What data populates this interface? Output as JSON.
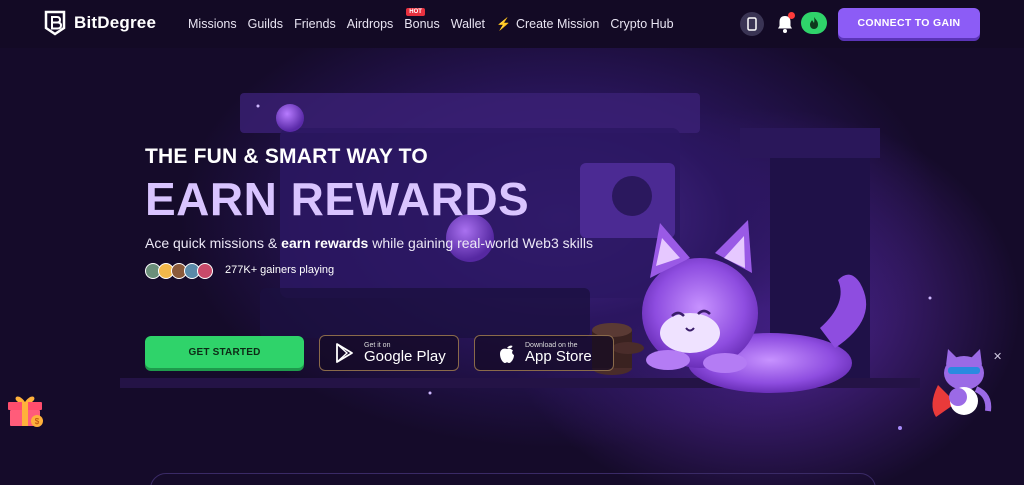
{
  "brand": {
    "name": "BitDegree"
  },
  "nav": {
    "links": [
      {
        "label": "Missions"
      },
      {
        "label": "Guilds"
      },
      {
        "label": "Friends"
      },
      {
        "label": "Airdrops"
      },
      {
        "label": "Bonus",
        "badge": "HOT"
      },
      {
        "label": "Wallet"
      },
      {
        "label": "Create Mission",
        "icon": "lightning-icon"
      },
      {
        "label": "Crypto Hub"
      }
    ],
    "connect_label": "CONNECT TO GAIN"
  },
  "hero": {
    "headline_1": "THE FUN & SMART WAY TO",
    "headline_2": "EARN REWARDS",
    "subtitle_pre": "Ace quick missions & ",
    "subtitle_bold": "earn rewards",
    "subtitle_post": " while gaining real-world Web3 skills",
    "gainers_text": "277K+ gainers playing",
    "get_started": "GET STARTED",
    "google_play": {
      "small": "Get it on",
      "big": "Google Play"
    },
    "app_store": {
      "small": "Download on the",
      "big": "App Store"
    }
  },
  "colors": {
    "accent_purple": "#8c5cf6",
    "cta_green": "#2fd36a",
    "headline_lilac": "#d9c4ff",
    "background": "#150b2a"
  }
}
